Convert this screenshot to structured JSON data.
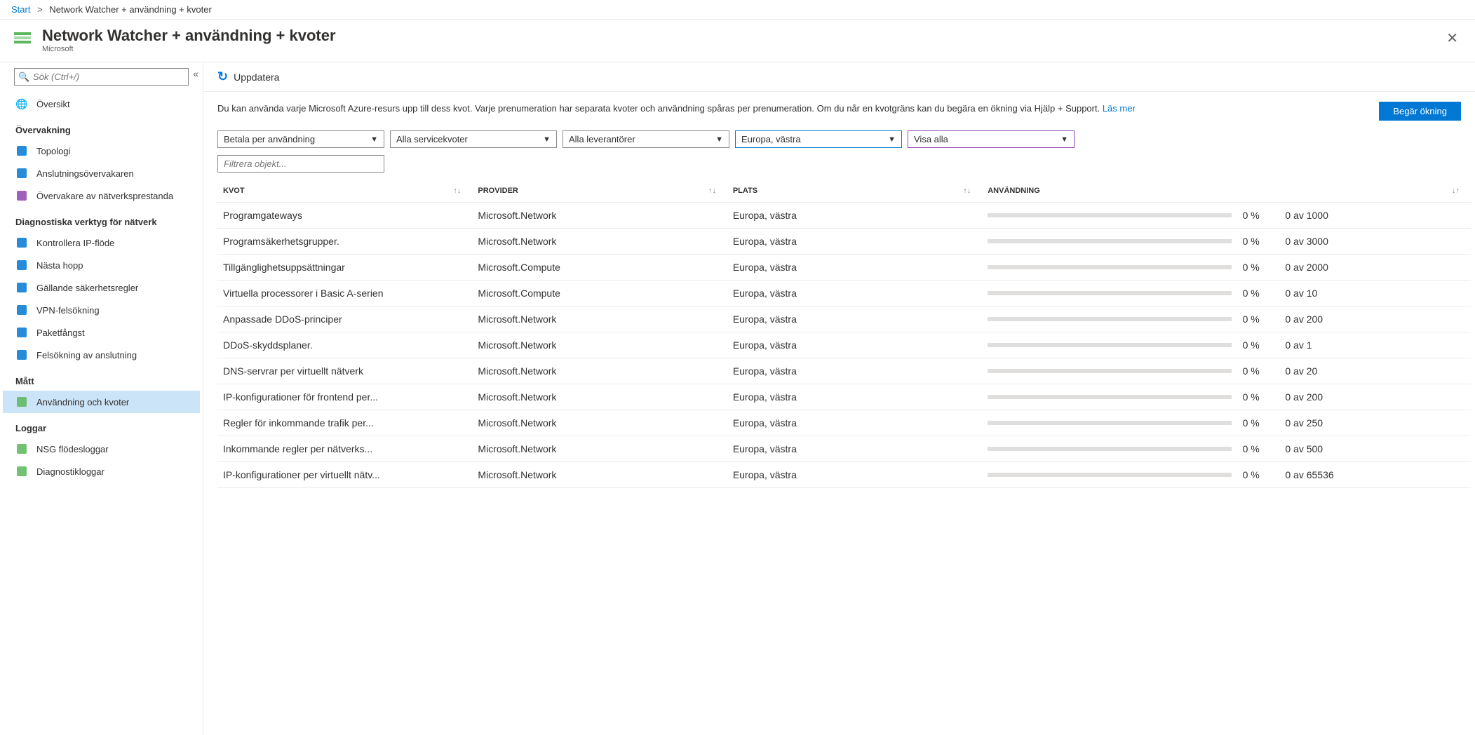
{
  "breadcrumb": {
    "root": "Start",
    "current": "Network Watcher + användning + kvoter"
  },
  "header": {
    "title": "Network Watcher + användning + kvoter",
    "subtitle": "Microsoft"
  },
  "sidebar": {
    "search_placeholder": "Sök (Ctrl+/)",
    "overview": "Översikt",
    "sections": [
      {
        "title": "Övervakning",
        "items": [
          {
            "label": "Topologi",
            "icon": "topology-icon",
            "color": "#0078d4"
          },
          {
            "label": "Anslutningsövervakaren",
            "icon": "connection-monitor-icon",
            "color": "#0078d4"
          },
          {
            "label": "Övervakare av nätverksprestanda",
            "icon": "npn-monitor-icon",
            "color": "#8e44ad"
          }
        ]
      },
      {
        "title": "Diagnostiska verktyg för nätverk",
        "items": [
          {
            "label": "Kontrollera IP-flöde",
            "icon": "ip-flow-icon",
            "color": "#0078d4"
          },
          {
            "label": "Nästa hopp",
            "icon": "next-hop-icon",
            "color": "#0078d4"
          },
          {
            "label": "Gällande säkerhetsregler",
            "icon": "security-rules-icon",
            "color": "#0078d4"
          },
          {
            "label": "VPN-felsökning",
            "icon": "vpn-troubleshoot-icon",
            "color": "#0078d4"
          },
          {
            "label": "Paketfångst",
            "icon": "packet-capture-icon",
            "color": "#0078d4"
          },
          {
            "label": "Felsökning av anslutning",
            "icon": "connection-troubleshoot-icon",
            "color": "#0078d4"
          }
        ]
      },
      {
        "title": "Mått",
        "items": [
          {
            "label": "Användning och kvoter",
            "icon": "usage-quotas-icon",
            "color": "#5bb75b",
            "selected": true
          }
        ]
      },
      {
        "title": "Loggar",
        "items": [
          {
            "label": "NSG flödesloggar",
            "icon": "nsg-flow-icon",
            "color": "#5bb75b"
          },
          {
            "label": "Diagnostikloggar",
            "icon": "diagnostic-logs-icon",
            "color": "#5bb75b"
          }
        ]
      }
    ]
  },
  "toolbar": {
    "refresh": "Uppdatera"
  },
  "info": {
    "text": "Du kan använda varje Microsoft Azure-resurs upp till dess kvot. Varje prenumeration har separata kvoter och användning spåras per prenumeration. Om du når en kvotgräns kan du begära en ökning via Hjälp + Support. ",
    "link": "Läs mer",
    "request_button": "Begär ökning"
  },
  "filters": {
    "subscription": "Betala per användning",
    "quota": "Alla servicekvoter",
    "provider": "Alla leverantörer",
    "region": "Europa, västra",
    "show": "Visa alla",
    "filter_placeholder": "Filtrera objekt..."
  },
  "table": {
    "headers": {
      "quota": "KVOT",
      "provider": "PROVIDER",
      "location": "PLATS",
      "usage": "ANVÄNDNING"
    },
    "rows": [
      {
        "quota": "Programgateways",
        "provider": "Microsoft.Network",
        "location": "Europa, västra",
        "pct": "0 %",
        "usage": "0 av 1000"
      },
      {
        "quota": "Programsäkerhetsgrupper.",
        "provider": "Microsoft.Network",
        "location": "Europa, västra",
        "pct": "0 %",
        "usage": "0 av 3000"
      },
      {
        "quota": "Tillgänglighetsuppsättningar",
        "provider": "Microsoft.Compute",
        "location": "Europa, västra",
        "pct": "0 %",
        "usage": "0 av 2000"
      },
      {
        "quota": "Virtuella processorer i Basic A-serien",
        "provider": "Microsoft.Compute",
        "location": "Europa, västra",
        "pct": "0 %",
        "usage": "0 av 10"
      },
      {
        "quota": "Anpassade DDoS-principer",
        "provider": "Microsoft.Network",
        "location": "Europa, västra",
        "pct": "0 %",
        "usage": "0 av 200"
      },
      {
        "quota": "DDoS-skyddsplaner.",
        "provider": "Microsoft.Network",
        "location": "Europa, västra",
        "pct": "0 %",
        "usage": "0 av 1"
      },
      {
        "quota": "DNS-servrar per virtuellt nätverk",
        "provider": "Microsoft.Network",
        "location": "Europa, västra",
        "pct": "0 %",
        "usage": "0 av 20"
      },
      {
        "quota": "IP-konfigurationer för frontend per...",
        "provider": "Microsoft.Network",
        "location": "Europa, västra",
        "pct": "0 %",
        "usage": "0 av 200"
      },
      {
        "quota": "Regler för inkommande trafik per...",
        "provider": "Microsoft.Network",
        "location": "Europa, västra",
        "pct": "0 %",
        "usage": "0 av 250"
      },
      {
        "quota": "Inkommande regler per nätverks...",
        "provider": "Microsoft.Network",
        "location": "Europa, västra",
        "pct": "0 %",
        "usage": "0 av 500"
      },
      {
        "quota": "IP-konfigurationer per virtuellt nätv...",
        "provider": "Microsoft.Network",
        "location": "Europa, västra",
        "pct": "0 %",
        "usage": "0 av 65536"
      }
    ]
  }
}
